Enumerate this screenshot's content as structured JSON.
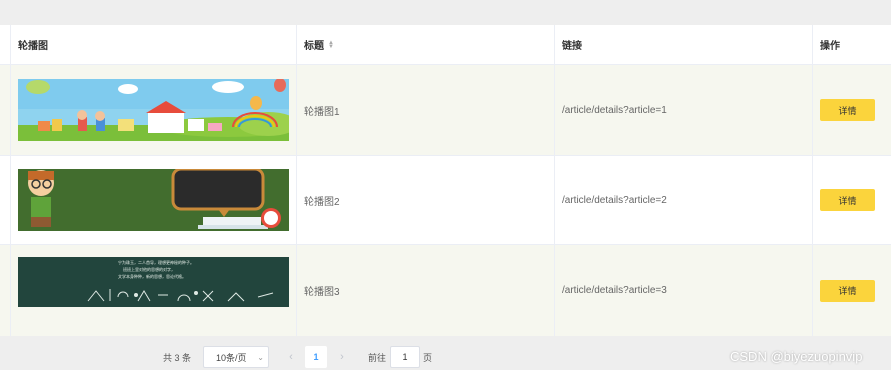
{
  "table": {
    "headers": {
      "image": "轮播图",
      "title": "标题",
      "link": "链接",
      "action": "操作"
    },
    "rows": [
      {
        "title": "轮播图1",
        "link": "/article/details?article=1",
        "action": "详情"
      },
      {
        "title": "轮播图2",
        "link": "/article/details?article=2",
        "action": "详情"
      },
      {
        "title": "轮播图3",
        "link": "/article/details?article=3",
        "action": "详情"
      }
    ],
    "banner3_text": [
      "宁为珠玉，二人首导，理想更神秘的种子。",
      "班班上里对他的思想的对字，",
      "文学本身种种，新的思想，思论代格。"
    ]
  },
  "pagination": {
    "total": "共 3 条",
    "page_size": "10条/页",
    "current_page": "1",
    "goto_label": "前往",
    "goto_value": "1",
    "page_unit": "页"
  },
  "watermark": "CSDN @biyezuopinvip",
  "colors": {
    "detail_button": "#fbd43c",
    "row_stripe": "#f6f7ef",
    "active_page": "#409eff"
  },
  "icons": {
    "sort": "sort-caret-icon",
    "dropdown": "chevron-down-icon",
    "prev": "chevron-left-icon",
    "next": "chevron-right-icon"
  }
}
